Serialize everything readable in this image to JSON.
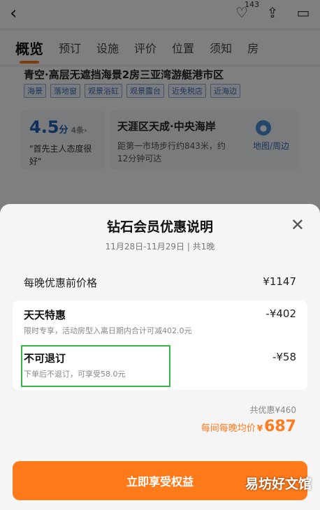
{
  "header": {
    "back_icon": "back-chevron-icon",
    "favorite_count": "143",
    "icons": [
      "heart-icon",
      "share-icon",
      "message-icon"
    ]
  },
  "tabs": [
    {
      "label": "概览",
      "active": true
    },
    {
      "label": "预订"
    },
    {
      "label": "设施"
    },
    {
      "label": "评价"
    },
    {
      "label": "位置"
    },
    {
      "label": "须知"
    },
    {
      "label": "房"
    }
  ],
  "hotel": {
    "title_partial": "青空·高层无遮挡海景2房三亚湾游艇港市区",
    "tags": [
      "海景",
      "落地窗",
      "观景浴缸",
      "观景露台",
      "近免税店",
      "近海边"
    ],
    "rating": {
      "score": "4.5",
      "unit": "分",
      "count": "4条›",
      "quote": "\"首先主人态度很好\""
    },
    "location": {
      "title": "天涯区天成·中央海岸",
      "distance": "距第一市场步行约843米，约12分钟可达",
      "map_label": "地图/周边"
    }
  },
  "modal": {
    "title": "钻石会员优惠说明",
    "dates": "11月28日-11月29日 | 共1晚",
    "base_price_label": "每晚优惠前价格",
    "base_price_value": "¥1147",
    "items": [
      {
        "name": "天天特惠",
        "amount": "-¥402",
        "desc": "限时专享，活动房型入离日期内合计可减402.0元"
      },
      {
        "name": "不可退订",
        "amount": "-¥58",
        "desc": "下单后不退订，可享受58.0元"
      }
    ],
    "total_discount": "共优惠¥460",
    "avg_label": "每间每晚均价",
    "avg_currency": "¥",
    "avg_value": "687",
    "cta": "立即享受权益",
    "close_icon": "close-icon"
  },
  "watermark": "易坊好文馆",
  "colors": {
    "accent": "#ff7a1a",
    "highlight_box": "#36b845",
    "tag_blue": "#3b6fb6"
  }
}
